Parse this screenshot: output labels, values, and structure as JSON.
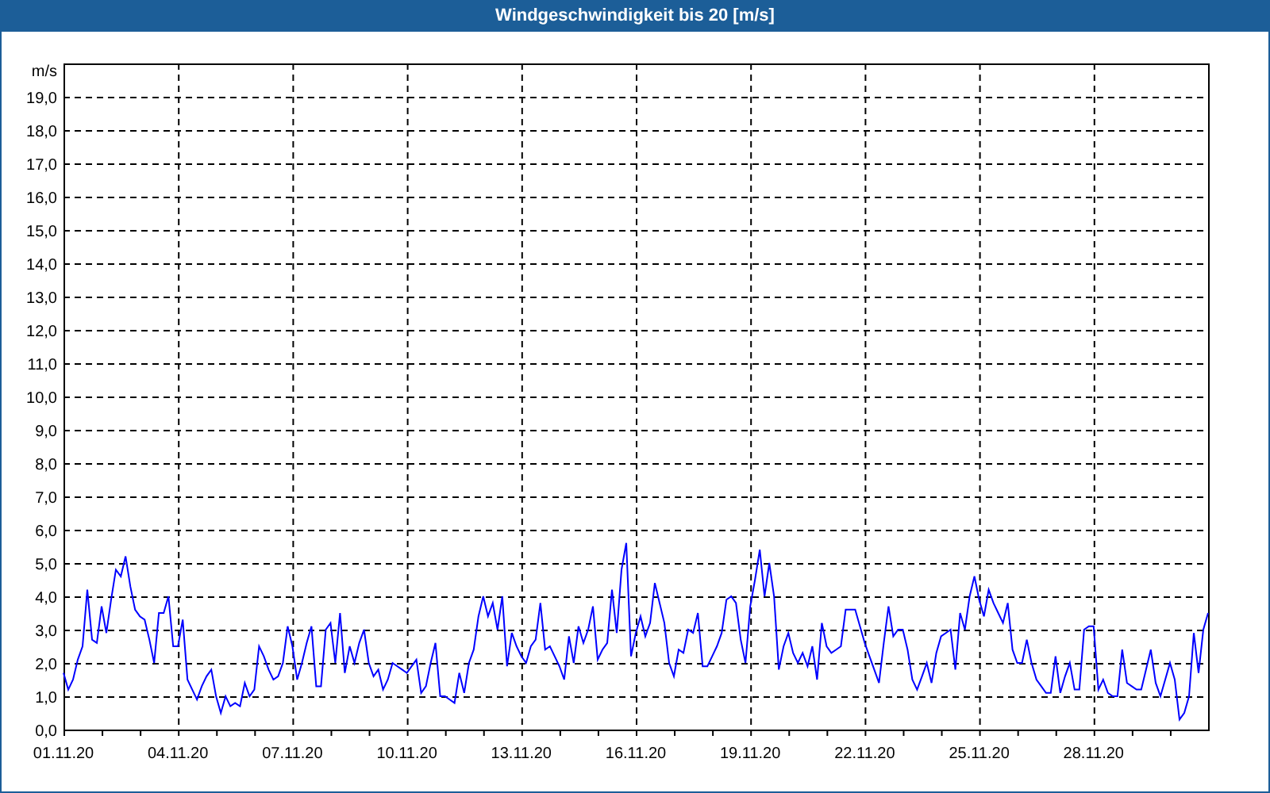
{
  "window": {
    "title": "Windgeschwindigkeit bis 20 [m/s]"
  },
  "chart": {
    "chart_data": {
      "type": "line",
      "grid": true,
      "ylabel": "m/s",
      "ylim": [
        0,
        20
      ],
      "yticks": [
        {
          "value": 0,
          "label": "0,0"
        },
        {
          "value": 1,
          "label": "1,0"
        },
        {
          "value": 2,
          "label": "2,0"
        },
        {
          "value": 3,
          "label": "3,0"
        },
        {
          "value": 4,
          "label": "4,0"
        },
        {
          "value": 5,
          "label": "5,0"
        },
        {
          "value": 6,
          "label": "6,0"
        },
        {
          "value": 7,
          "label": "7,0"
        },
        {
          "value": 8,
          "label": "8,0"
        },
        {
          "value": 9,
          "label": "9,0"
        },
        {
          "value": 10,
          "label": "10,0"
        },
        {
          "value": 11,
          "label": "11,0"
        },
        {
          "value": 12,
          "label": "12,0"
        },
        {
          "value": 13,
          "label": "13,0"
        },
        {
          "value": 14,
          "label": "14,0"
        },
        {
          "value": 15,
          "label": "15,0"
        },
        {
          "value": 16,
          "label": "16,0"
        },
        {
          "value": 17,
          "label": "17,0"
        },
        {
          "value": 18,
          "label": "18,0"
        },
        {
          "value": 19,
          "label": "19,0"
        }
      ],
      "categories": [
        "01.11.20",
        null,
        null,
        null,
        null,
        null,
        null,
        null,
        null,
        null,
        null,
        null,
        null,
        null,
        null,
        null,
        null,
        null,
        null,
        null,
        null,
        null,
        null,
        null,
        "04.11.20",
        null,
        null,
        null,
        null,
        null,
        null,
        null,
        null,
        null,
        null,
        null,
        null,
        null,
        null,
        null,
        null,
        null,
        null,
        null,
        null,
        null,
        null,
        null,
        "07.11.20",
        null,
        null,
        null,
        null,
        null,
        null,
        null,
        null,
        null,
        null,
        null,
        null,
        null,
        null,
        null,
        null,
        null,
        null,
        null,
        null,
        null,
        null,
        null,
        "10.11.20",
        null,
        null,
        null,
        null,
        null,
        null,
        null,
        null,
        null,
        null,
        null,
        null,
        null,
        null,
        null,
        null,
        null,
        null,
        null,
        null,
        null,
        null,
        null,
        "13.11.20",
        null,
        null,
        null,
        null,
        null,
        null,
        null,
        null,
        null,
        null,
        null,
        null,
        null,
        null,
        null,
        null,
        null,
        null,
        null,
        null,
        null,
        null,
        null,
        "16.11.20",
        null,
        null,
        null,
        null,
        null,
        null,
        null,
        null,
        null,
        null,
        null,
        null,
        null,
        null,
        null,
        null,
        null,
        null,
        null,
        null,
        null,
        null,
        null,
        "19.11.20",
        null,
        null,
        null,
        null,
        null,
        null,
        null,
        null,
        null,
        null,
        null,
        null,
        null,
        null,
        null,
        null,
        null,
        null,
        null,
        null,
        null,
        null,
        null,
        "22.11.20",
        null,
        null,
        null,
        null,
        null,
        null,
        null,
        null,
        null,
        null,
        null,
        null,
        null,
        null,
        null,
        null,
        null,
        null,
        null,
        null,
        null,
        null,
        null,
        "25.11.20",
        null,
        null,
        null,
        null,
        null,
        null,
        null,
        null,
        null,
        null,
        null,
        null,
        null,
        null,
        null,
        null,
        null,
        null,
        null,
        null,
        null,
        null,
        null,
        "28.11.20",
        null,
        null,
        null,
        null,
        null,
        null,
        null,
        null,
        null,
        null,
        null,
        null,
        null,
        null,
        null,
        null,
        null,
        null,
        null,
        null,
        null,
        null,
        null,
        null
      ],
      "series": [
        {
          "color": "#0000ff",
          "values": [
            1.7,
            1.2,
            1.5,
            2.1,
            2.5,
            4.2,
            2.7,
            2.6,
            3.7,
            2.9,
            3.9,
            4.8,
            4.6,
            5.2,
            4.3,
            3.6,
            3.4,
            3.3,
            2.7,
            2.0,
            3.5,
            3.5,
            4.0,
            2.5,
            2.5,
            3.3,
            1.5,
            1.2,
            0.9,
            1.3,
            1.6,
            1.8,
            1.0,
            0.5,
            1.0,
            0.7,
            0.8,
            0.7,
            1.4,
            1.0,
            1.2,
            2.5,
            2.2,
            1.8,
            1.5,
            1.6,
            2.0,
            3.1,
            2.5,
            1.5,
            2.0,
            2.6,
            3.1,
            1.3,
            1.3,
            3.0,
            3.2,
            2.0,
            3.5,
            1.7,
            2.5,
            2.0,
            2.6,
            3.0,
            2.0,
            1.6,
            1.8,
            1.2,
            1.5,
            2.0,
            1.9,
            1.8,
            1.7,
            1.9,
            2.1,
            1.1,
            1.3,
            2.0,
            2.6,
            1.0,
            1.0,
            0.9,
            0.8,
            1.7,
            1.1,
            2.0,
            2.4,
            3.4,
            4.0,
            3.4,
            3.8,
            3.0,
            4.0,
            1.9,
            2.9,
            2.5,
            2.2,
            2.0,
            2.5,
            2.7,
            3.8,
            2.4,
            2.5,
            2.2,
            1.9,
            1.5,
            2.8,
            2.0,
            3.1,
            2.6,
            3.0,
            3.7,
            2.1,
            2.4,
            2.6,
            4.2,
            2.9,
            4.8,
            5.6,
            2.2,
            2.9,
            3.4,
            2.8,
            3.2,
            4.4,
            3.8,
            3.2,
            2.0,
            1.6,
            2.4,
            2.3,
            3.0,
            2.9,
            3.5,
            1.9,
            1.9,
            2.2,
            2.5,
            2.9,
            3.9,
            4.0,
            3.8,
            2.7,
            2.0,
            3.7,
            4.5,
            5.4,
            4.0,
            5.0,
            4.0,
            1.8,
            2.5,
            2.9,
            2.3,
            2.0,
            2.3,
            1.9,
            2.5,
            1.5,
            3.2,
            2.5,
            2.3,
            2.4,
            2.5,
            3.6,
            3.6,
            3.6,
            3.1,
            2.6,
            2.2,
            1.8,
            1.4,
            2.6,
            3.7,
            2.8,
            3.0,
            3.0,
            2.4,
            1.5,
            1.2,
            1.6,
            2.0,
            1.4,
            2.3,
            2.8,
            2.9,
            3.0,
            1.8,
            3.5,
            3.0,
            4.0,
            4.6,
            3.9,
            3.4,
            4.2,
            3.8,
            3.5,
            3.2,
            3.8,
            2.4,
            2.0,
            2.0,
            2.7,
            2.0,
            1.5,
            1.3,
            1.1,
            1.1,
            2.2,
            1.1,
            1.6,
            2.0,
            1.2,
            1.2,
            3.0,
            3.1,
            3.1,
            1.2,
            1.5,
            1.1,
            1.0,
            1.0,
            2.4,
            1.4,
            1.3,
            1.2,
            1.2,
            1.8,
            2.4,
            1.4,
            1.0,
            1.5,
            2.0,
            1.5,
            0.3,
            0.5,
            1.0,
            2.9,
            1.7,
            3.0,
            3.5
          ]
        }
      ]
    }
  }
}
